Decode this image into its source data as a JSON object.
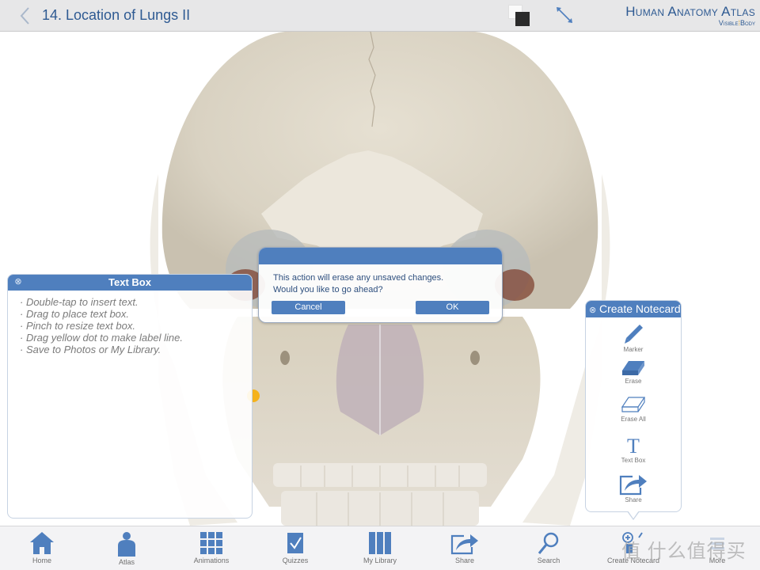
{
  "header": {
    "title": "14. Location of Lungs II",
    "brand_main": "Human Anatomy Atlas",
    "brand_sub_left": "Visible",
    "brand_sub_right": "Body"
  },
  "dialog": {
    "message_line1": "This action will erase any unsaved changes.",
    "message_line2": "Would you like to go ahead?",
    "cancel_label": "Cancel",
    "ok_label": "OK"
  },
  "text_box_panel": {
    "title": "Text Box",
    "close_glyph": "⊗",
    "instructions": [
      "· Double-tap to insert text.",
      "· Drag to place text box.",
      "· Pinch to resize text box.",
      "· Drag yellow dot to make label line.",
      "· Save to Photos or My Library."
    ]
  },
  "notecard_panel": {
    "title": "Create Notecard",
    "close_glyph": "⊗",
    "tools": [
      {
        "label": "Marker",
        "icon": "marker-icon"
      },
      {
        "label": "Erase",
        "icon": "eraser-icon"
      },
      {
        "label": "Erase All",
        "icon": "erase-all-icon"
      },
      {
        "label": "Text Box",
        "icon": "text-box-icon"
      },
      {
        "label": "Share",
        "icon": "share-icon"
      }
    ]
  },
  "tabbar": {
    "items": [
      {
        "label": "Home",
        "icon": "home-icon"
      },
      {
        "label": "Atlas",
        "icon": "atlas-icon"
      },
      {
        "label": "Animations",
        "icon": "animations-icon"
      },
      {
        "label": "Quizzes",
        "icon": "quizzes-icon"
      },
      {
        "label": "My Library",
        "icon": "library-icon"
      },
      {
        "label": "Share",
        "icon": "share-icon"
      },
      {
        "label": "Search",
        "icon": "search-icon"
      },
      {
        "label": "Create Notecard",
        "icon": "create-notecard-icon"
      },
      {
        "label": "More",
        "icon": "more-icon"
      }
    ]
  },
  "watermark": "值 什么值得买",
  "colors": {
    "accent": "#4f7fbe",
    "title_text": "#2e5a92",
    "label_marker": "#f5b21b"
  }
}
